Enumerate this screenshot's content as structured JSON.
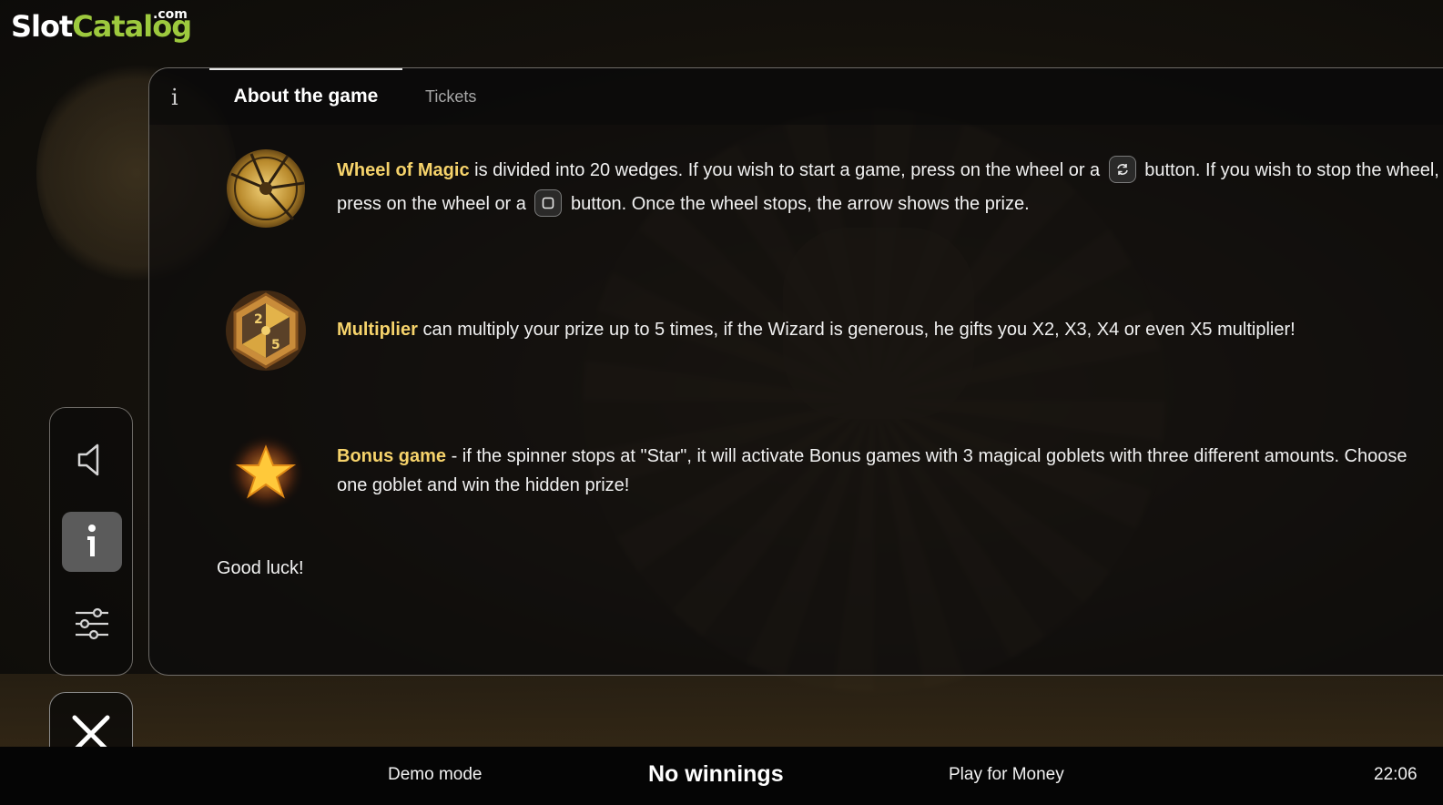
{
  "logo": {
    "slot": "Slot",
    "catalog": "Catalog",
    "com": ".com"
  },
  "tabs": {
    "info_icon": "i",
    "about": "About the game",
    "tickets": "Tickets"
  },
  "rows": [
    {
      "icon": "wheel-of-magic-icon",
      "highlight": "Wheel of Magic",
      "text_part1": " is divided into 20 wedges. If you wish to start a game, press on the wheel or a ",
      "text_part2": " button. If you wish to stop the wheel, press on the wheel or a ",
      "text_part3": " button. Once the wheel stops, the arrow shows the prize."
    },
    {
      "icon": "multiplier-icon",
      "highlight": "Multiplier",
      "text": " can multiply your prize up to 5 times, if the Wizard is generous, he gifts you X2, X3, X4 or even X5 multiplier!"
    },
    {
      "icon": "star-icon",
      "highlight": "Bonus game",
      "text": " - if the spinner stops at \"Star\", it will activate Bonus games with 3 magical goblets with three different amounts. Choose one goblet and win the hidden prize!"
    }
  ],
  "good_luck": "Good luck!",
  "side_controls": [
    "sound-icon",
    "info-icon",
    "settings-icon"
  ],
  "bottom_bar": {
    "demo_mode": "Demo mode",
    "winnings": "No winnings",
    "play_for_money": "Play for Money",
    "time": "22:06"
  },
  "colors": {
    "highlight": "#f6d36b",
    "logo_green": "#9dc93e",
    "active_side_button": "#5b5b5b"
  }
}
